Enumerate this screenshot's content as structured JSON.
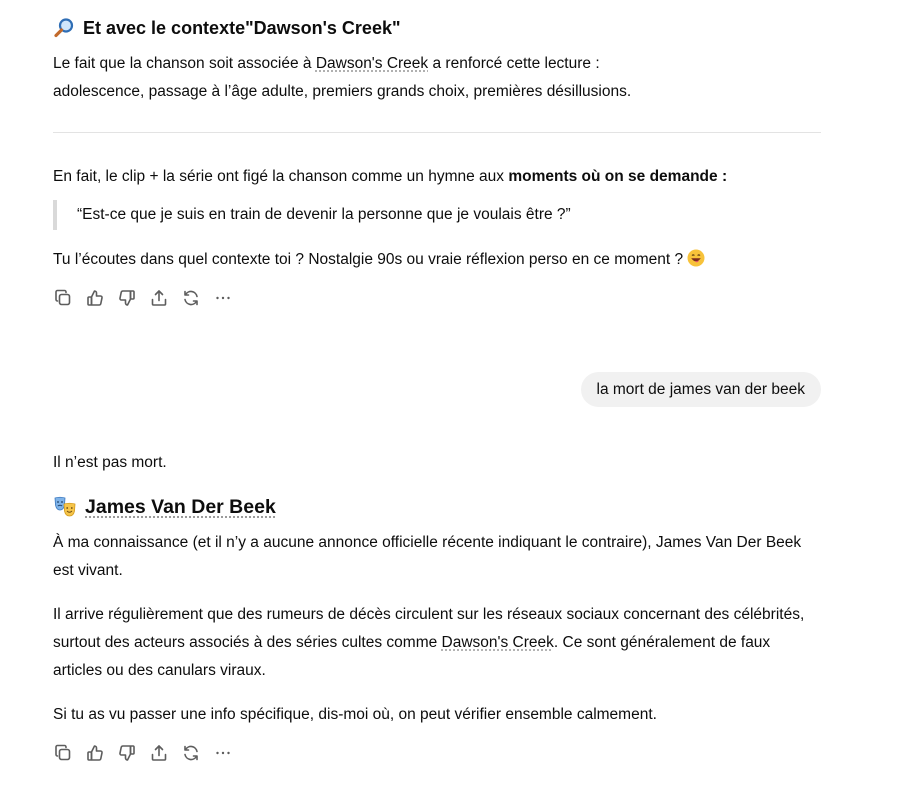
{
  "section1": {
    "heading_prefix": "Et avec le contexte ",
    "heading_quoted": "\"Dawson's Creek\"",
    "para1_before": "Le fait que la chanson soit associée à ",
    "para1_link": "Dawson's Creek",
    "para1_after": " a renforcé cette lecture :",
    "para1_line2": "adolescence, passage à l’âge adulte, premiers grands choix, premières désillusions."
  },
  "section2": {
    "intro_before": "En fait, le clip + la série ont figé la chanson comme un hymne aux ",
    "intro_bold": "moments où on se demande :",
    "quote": "“Est-ce que je suis en train de devenir la personne que je voulais être ?”",
    "question": "Tu l’écoutes dans quel contexte toi ? Nostalgie 90s ou vraie réflexion perso en ce moment ?"
  },
  "actions": [
    "copy-icon",
    "thumbs-up-icon",
    "thumbs-down-icon",
    "share-icon",
    "regenerate-icon",
    "more-icon"
  ],
  "user_message": "la mort de james van der beek",
  "reply": {
    "opening": "Il n’est pas mort.",
    "heading": "James Van Der Beek",
    "p1_line1": "À ma connaissance (et il n’y a aucune annonce officielle récente indiquant le contraire), James Van Der Beek",
    "p1_line2": "est vivant.",
    "p2_line1": "Il arrive régulièrement que des rumeurs de décès circulent sur les réseaux sociaux concernant des célébrités,",
    "p2_line2_before": "surtout des acteurs associés à des séries cultes comme ",
    "p2_line2_link": "Dawson's Creek",
    "p2_line2_after": ". Ce sont généralement de faux",
    "p2_line3": "articles ou des canulars viraux.",
    "p3": "Si tu as vu passer une info spécifique, dis-moi où, on peut vérifier ensemble calmement."
  },
  "colors": {
    "bubble_bg": "#f1f1f1",
    "text": "#0d0d0d",
    "icon": "#5d5d5d"
  }
}
